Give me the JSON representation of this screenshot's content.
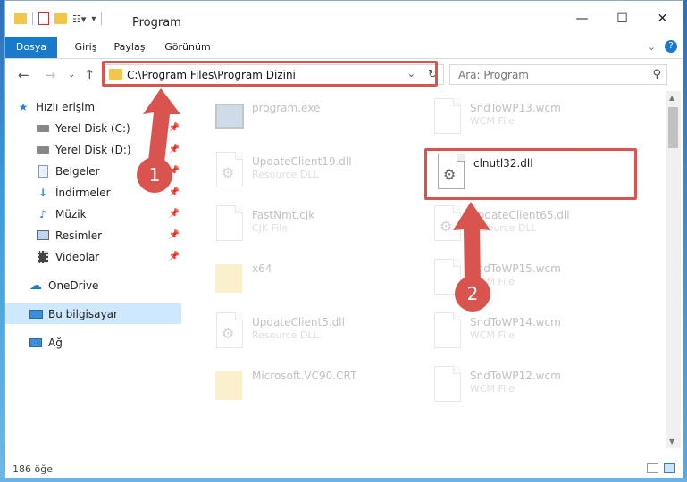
{
  "window": {
    "title": "Program"
  },
  "ribbon": {
    "tabs": [
      "Dosya",
      "Giriş",
      "Paylaş",
      "Görünüm"
    ]
  },
  "address": {
    "path": "C:\\Program Files\\Program Dizini"
  },
  "search": {
    "placeholder": "Ara: Program"
  },
  "sidebar": {
    "items": [
      {
        "label": "Hızlı erişim",
        "icon": "star-icon"
      },
      {
        "label": "Yerel Disk (C:)",
        "icon": "drive-icon"
      },
      {
        "label": "Yerel Disk (D:)",
        "icon": "drive-icon"
      },
      {
        "label": "Belgeler",
        "icon": "documents-icon"
      },
      {
        "label": "İndirmeler",
        "icon": "download-icon"
      },
      {
        "label": "Müzik",
        "icon": "music-icon"
      },
      {
        "label": "Resimler",
        "icon": "pictures-icon"
      },
      {
        "label": "Videolar",
        "icon": "video-icon"
      },
      {
        "label": "OneDrive",
        "icon": "cloud-icon"
      },
      {
        "label": "Bu bilgisayar",
        "icon": "computer-icon"
      },
      {
        "label": "Ağ",
        "icon": "network-icon"
      }
    ]
  },
  "files": [
    {
      "name": "program.exe",
      "type": ""
    },
    {
      "name": "SndToWP13.wcm",
      "type": "WCM File"
    },
    {
      "name": "UpdateClient19.dll",
      "type": "Resource DLL"
    },
    {
      "name": "clnutl32.dll",
      "type": ""
    },
    {
      "name": "FastNmt.cjk",
      "type": "CJK File"
    },
    {
      "name": "UpdateClient65.dll",
      "type": "Resource DLL"
    },
    {
      "name": "x64",
      "type": ""
    },
    {
      "name": "SndToWP15.wcm",
      "type": "WCM File"
    },
    {
      "name": "UpdateClient5.dll",
      "type": "Resource DLL"
    },
    {
      "name": "SndToWP14.wcm",
      "type": "WCM File"
    },
    {
      "name": "Microsoft.VC90.CRT",
      "type": ""
    },
    {
      "name": "SndToWP12.wcm",
      "type": "WCM File"
    }
  ],
  "status": {
    "count": "186 öğe"
  },
  "annotations": {
    "step1": "1",
    "step2": "2"
  },
  "colors": {
    "accent": "#1979ca",
    "highlight": "#d9534f",
    "selection": "#cde8ff"
  }
}
